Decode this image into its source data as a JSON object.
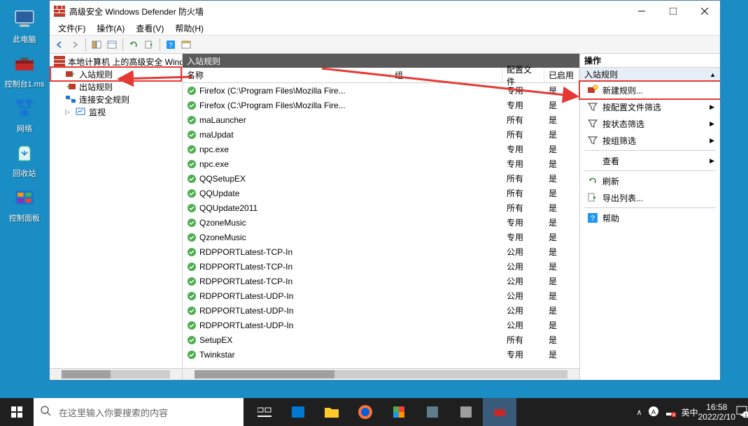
{
  "desktop": {
    "items": [
      {
        "label": "此电脑"
      },
      {
        "label": "控制台1.ms"
      },
      {
        "label": "网络"
      },
      {
        "label": "回收站"
      },
      {
        "label": "控制面板"
      }
    ]
  },
  "window": {
    "title": "高级安全 Windows Defender 防火墙",
    "menu": {
      "file": "文件(F)",
      "action": "操作(A)",
      "view": "查看(V)",
      "help": "帮助(H)"
    },
    "tree": {
      "root": "本地计算机 上的高级安全 Wind",
      "items": [
        {
          "label": "入站规则"
        },
        {
          "label": "出站规则"
        },
        {
          "label": "连接安全规则"
        },
        {
          "label": "监视"
        }
      ]
    },
    "list": {
      "header": "入站规则",
      "columns": {
        "name": "名称",
        "group": "组",
        "profile": "配置文件",
        "enabled": "已启用"
      },
      "rows": [
        {
          "name": "Firefox (C:\\Program Files\\Mozilla Fire...",
          "group": "",
          "profile": "专用",
          "enabled": "是"
        },
        {
          "name": "Firefox (C:\\Program Files\\Mozilla Fire...",
          "group": "",
          "profile": "专用",
          "enabled": "是"
        },
        {
          "name": "maLauncher",
          "group": "",
          "profile": "所有",
          "enabled": "是"
        },
        {
          "name": "maUpdat",
          "group": "",
          "profile": "所有",
          "enabled": "是"
        },
        {
          "name": "npc.exe",
          "group": "",
          "profile": "专用",
          "enabled": "是"
        },
        {
          "name": "npc.exe",
          "group": "",
          "profile": "专用",
          "enabled": "是"
        },
        {
          "name": "QQSetupEX",
          "group": "",
          "profile": "所有",
          "enabled": "是"
        },
        {
          "name": "QQUpdate",
          "group": "",
          "profile": "所有",
          "enabled": "是"
        },
        {
          "name": "QQUpdate2011",
          "group": "",
          "profile": "所有",
          "enabled": "是"
        },
        {
          "name": "QzoneMusic",
          "group": "",
          "profile": "专用",
          "enabled": "是"
        },
        {
          "name": "QzoneMusic",
          "group": "",
          "profile": "专用",
          "enabled": "是"
        },
        {
          "name": "RDPPORTLatest-TCP-In",
          "group": "",
          "profile": "公用",
          "enabled": "是"
        },
        {
          "name": "RDPPORTLatest-TCP-In",
          "group": "",
          "profile": "公用",
          "enabled": "是"
        },
        {
          "name": "RDPPORTLatest-TCP-In",
          "group": "",
          "profile": "公用",
          "enabled": "是"
        },
        {
          "name": "RDPPORTLatest-UDP-In",
          "group": "",
          "profile": "公用",
          "enabled": "是"
        },
        {
          "name": "RDPPORTLatest-UDP-In",
          "group": "",
          "profile": "公用",
          "enabled": "是"
        },
        {
          "name": "RDPPORTLatest-UDP-In",
          "group": "",
          "profile": "公用",
          "enabled": "是"
        },
        {
          "name": "SetupEX",
          "group": "",
          "profile": "所有",
          "enabled": "是"
        },
        {
          "name": "Twinkstar",
          "group": "",
          "profile": "专用",
          "enabled": "是"
        }
      ]
    },
    "actions": {
      "title": "操作",
      "section": "入站规则",
      "items": [
        {
          "label": "新建规则...",
          "icon": "new-rule"
        },
        {
          "label": "按配置文件筛选",
          "icon": "filter",
          "arrow": true
        },
        {
          "label": "按状态筛选",
          "icon": "filter",
          "arrow": true
        },
        {
          "label": "按组筛选",
          "icon": "filter",
          "arrow": true
        },
        {
          "label": "查看",
          "icon": "",
          "arrow": true,
          "sep_before": true
        },
        {
          "label": "刷新",
          "icon": "refresh",
          "sep_before": true
        },
        {
          "label": "导出列表...",
          "icon": "export"
        },
        {
          "label": "帮助",
          "icon": "help",
          "sep_before": true
        }
      ]
    }
  },
  "taskbar": {
    "search_placeholder": "在这里输入你要搜索的内容",
    "time": "16:58",
    "date": "2022/2/10",
    "ime": "中",
    "lang": "英"
  }
}
